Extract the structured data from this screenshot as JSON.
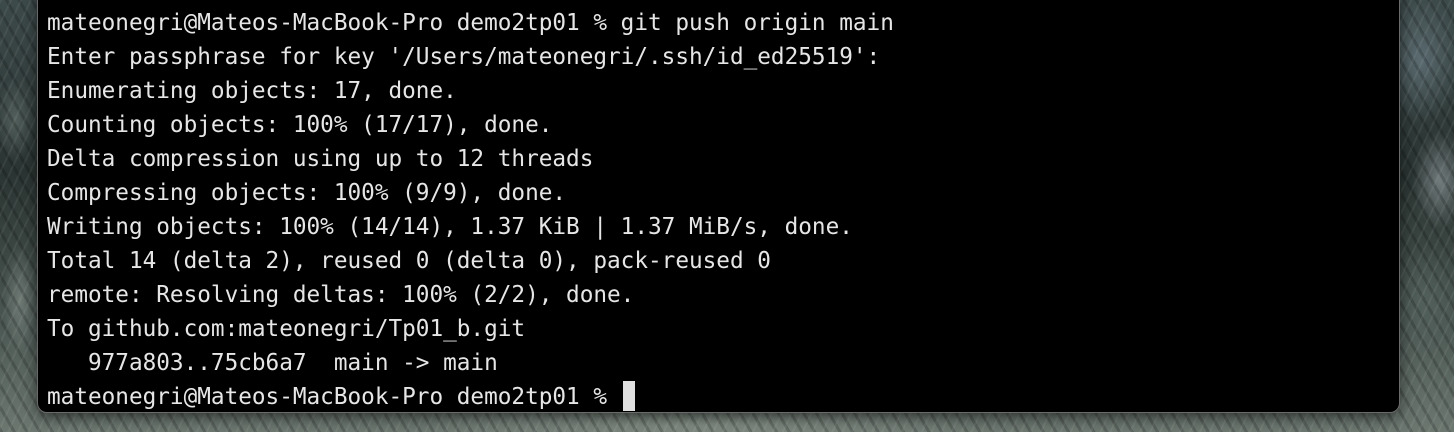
{
  "terminal": {
    "lines": [
      "mateonegri@Mateos-MacBook-Pro demo2tp01 % git push origin main",
      "Enter passphrase for key '/Users/mateonegri/.ssh/id_ed25519':",
      "Enumerating objects: 17, done.",
      "Counting objects: 100% (17/17), done.",
      "Delta compression using up to 12 threads",
      "Compressing objects: 100% (9/9), done.",
      "Writing objects: 100% (14/14), 1.37 KiB | 1.37 MiB/s, done.",
      "Total 14 (delta 2), reused 0 (delta 0), pack-reused 0",
      "remote: Resolving deltas: 100% (2/2), done.",
      "To github.com:mateonegri/Tp01_b.git",
      "   977a803..75cb6a7  main -> main"
    ],
    "prompt": "mateonegri@Mateos-MacBook-Pro demo2tp01 % "
  },
  "colors": {
    "background": "#000000",
    "text": "#e6e6e6",
    "cursor": "#e0e0e0"
  }
}
